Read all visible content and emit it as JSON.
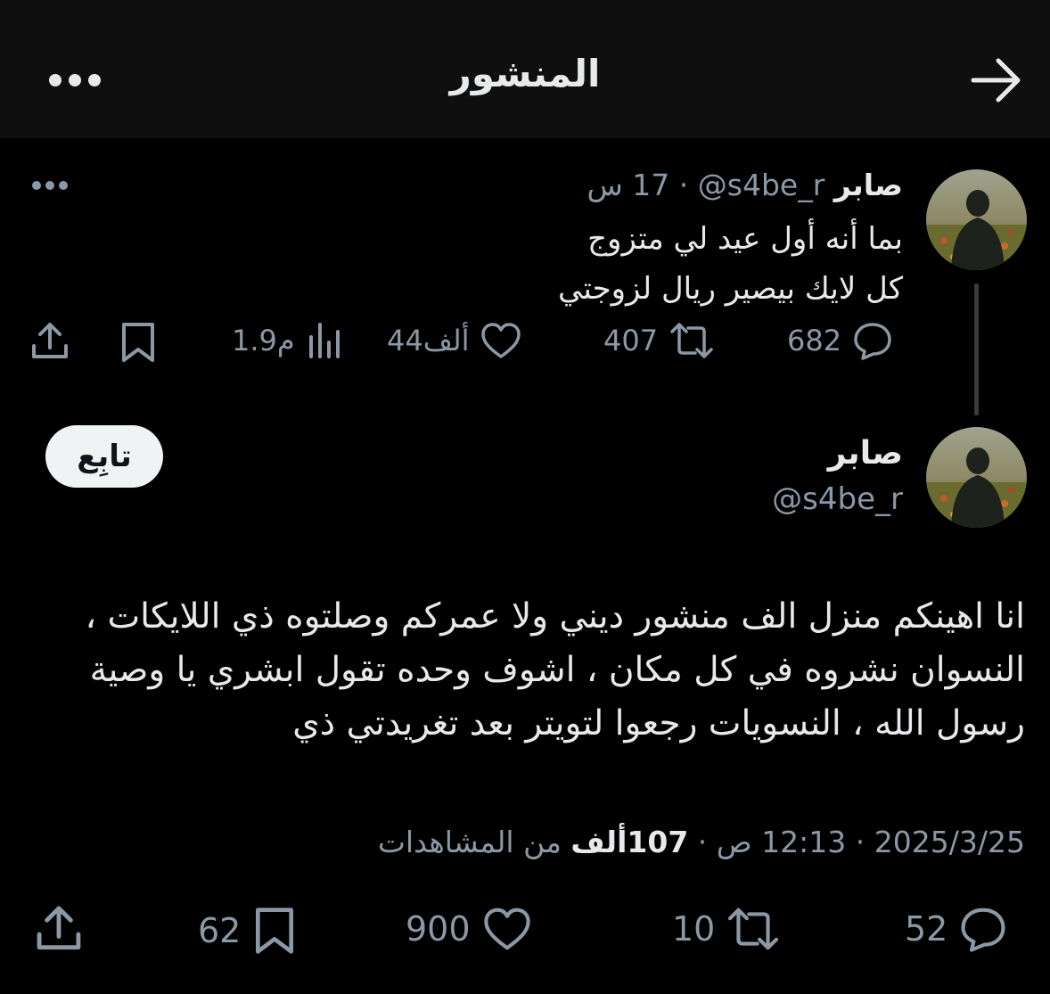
{
  "header": {
    "title": "المنشور"
  },
  "first_post": {
    "author_name": "صابر",
    "handle": "@s4be_r",
    "separator": "·",
    "time": "17 س",
    "lines": [
      "بما أنه أول عيد لي متزوج",
      "كل لايك بيصير ريال لزوجتي"
    ],
    "actions": {
      "replies": "682",
      "reposts": "407",
      "likes": "44ألف",
      "views": "1.9م"
    }
  },
  "main_post": {
    "author_name": "صابر",
    "handle": "@s4be_r",
    "follow_label": "تابِع",
    "body_lines": [
      "انا اهينكم منزل الف منشور ديني ولا عمركم وصلتوه ذي اللايكات ،",
      "النسوان نشروه في كل مكان ، اشوف وحده تقول ابشري يا وصية",
      "رسول الله ، النسويات رجعوا لتويتر بعد تغريدتي ذي"
    ],
    "date": "2025/3/25",
    "time": "12:13 ص",
    "separator": "·",
    "views_count": "107ألف",
    "views_label": "من المشاهدات",
    "actions": {
      "replies": "52",
      "reposts": "10",
      "likes": "900",
      "bookmarks": "62"
    }
  },
  "colors": {
    "background": "#000000",
    "header_bg": "#0f0f0f",
    "text": "#e7e9ea",
    "muted": "#8b98a5",
    "follow_bg": "#eff3f4"
  }
}
